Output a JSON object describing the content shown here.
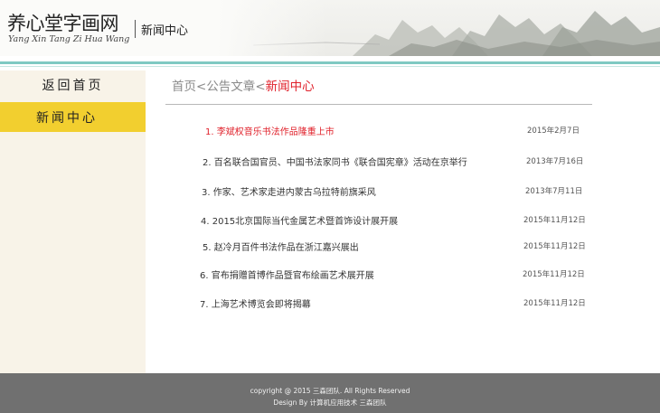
{
  "header": {
    "site_title": "养心堂字画网",
    "site_subtitle": "Yang Xin Tang Zi Hua Wang",
    "section_title": "新闻中心"
  },
  "sidebar": {
    "back_label": "返回首页",
    "news_label": "新闻中心"
  },
  "breadcrumb": {
    "home": "首页",
    "sep1": "<",
    "notices": "公告文章",
    "sep2": "<",
    "current": "新闻中心"
  },
  "news": [
    {
      "title": "1. 李斌权音乐书法作品隆重上市",
      "date": "2015年2月7日"
    },
    {
      "title": "2. 百名联合国官员、中国书法家同书《联合国宪章》活动在京举行",
      "date": "2013年7月16日"
    },
    {
      "title": "3. 作家、艺术家走进内蒙古乌拉特前旗采风",
      "date": "2013年7月11日"
    },
    {
      "title": "4. 2015北京国际当代金属艺术暨首饰设计展开展",
      "date": "2015年11月12日"
    },
    {
      "title": "5. 赵冷月百件书法作品在浙江嘉兴展出",
      "date": "2015年11月12日"
    },
    {
      "title": "6. 官布捐赠首博作品暨官布绘画艺术展开展",
      "date": "2015年11月12日"
    },
    {
      "title": "7. 上海艺术博览会即将揭幕",
      "date": "2015年11月12日"
    }
  ],
  "footer": {
    "copyright": "copyright @ 2015 三森团队. All Rights Reserved",
    "design": "Design By 计算机应用技术 三森团队"
  },
  "colors": {
    "accent_yellow": "#f2cf2f",
    "highlight_red": "#e0202a",
    "teal_rule": "#7fc9c2",
    "footer_gray": "#707070",
    "sidebar_bg": "#f8f3e8"
  }
}
